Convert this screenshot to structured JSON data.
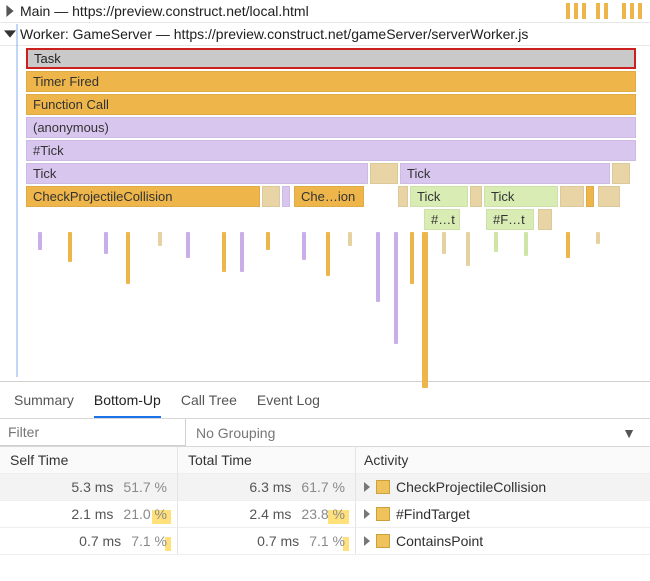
{
  "threads": {
    "main": "Main — https://preview.construct.net/local.html",
    "worker": "Worker: GameServer — https://preview.construct.net/gameServer/serverWorker.js"
  },
  "flame": {
    "r1": "Task",
    "r2": "Timer Fired",
    "r3": "Function Call",
    "r4": "(anonymous)",
    "r5": "#Tick",
    "r6a": "Tick",
    "r6b": "Tick",
    "r7a": "CheckProjectileCollision",
    "r7b": "Che…ion",
    "r7c": "Tick",
    "r7d": "Tick",
    "r8a": "#…t",
    "r8b": "#F…t"
  },
  "tabs": {
    "summary": "Summary",
    "bottomup": "Bottom-Up",
    "calltree": "Call Tree",
    "eventlog": "Event Log"
  },
  "controls": {
    "filter_placeholder": "Filter",
    "grouping": "No Grouping"
  },
  "columns": {
    "self": "Self Time",
    "total": "Total Time",
    "activity": "Activity"
  },
  "rows": [
    {
      "self_ms": "5.3 ms",
      "self_pct": "51.7 %",
      "total_ms": "6.3 ms",
      "total_pct": "61.7 %",
      "name": "CheckProjectileCollision"
    },
    {
      "self_ms": "2.1 ms",
      "self_pct": "21.0 %",
      "total_ms": "2.4 ms",
      "total_pct": "23.8 %",
      "name": "#FindTarget"
    },
    {
      "self_ms": "0.7 ms",
      "self_pct": "7.1 %",
      "total_ms": "0.7 ms",
      "total_pct": "7.1 %",
      "name": "ContainsPoint"
    }
  ]
}
